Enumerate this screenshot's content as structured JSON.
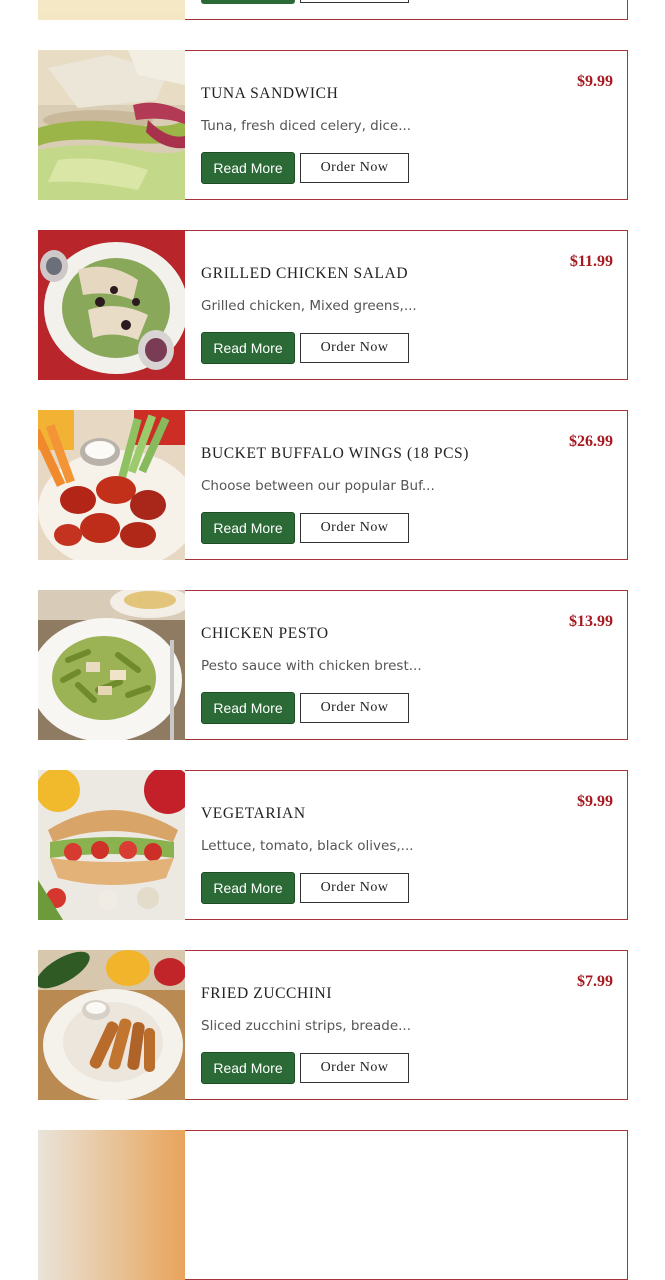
{
  "menu": {
    "items": [
      {
        "title": "TUNA SANDWICH",
        "price": "$9.99",
        "description": "Tuna, fresh diced celery, dice...",
        "image_icon": "tuna-sandwich-photo"
      },
      {
        "title": "GRILLED CHICKEN SALAD",
        "price": "$11.99",
        "description": "Grilled chicken, Mixed greens,...",
        "image_icon": "grilled-chicken-salad-photo"
      },
      {
        "title": "BUCKET BUFFALO WINGS (18 PCS)",
        "price": "$26.99",
        "description": "Choose between our popular Buf...",
        "image_icon": "buffalo-wings-photo"
      },
      {
        "title": "CHICKEN PESTO",
        "price": "$13.99",
        "description": "Pesto sauce with chicken brest...",
        "image_icon": "chicken-pesto-photo"
      },
      {
        "title": "VEGETARIAN",
        "price": "$9.99",
        "description": "Lettuce, tomato, black olives,...",
        "image_icon": "vegetarian-sandwich-photo"
      },
      {
        "title": "FRIED ZUCCHINI",
        "price": "$7.99",
        "description": "Sliced zucchini strips, breade...",
        "image_icon": "fried-zucchini-photo"
      }
    ]
  },
  "buttons": {
    "read_more": "Read More",
    "order_now": "Order Now"
  },
  "colors": {
    "card_border": "#a8323a",
    "price": "#a8191f",
    "read_more_bg": "#2b6a36"
  }
}
